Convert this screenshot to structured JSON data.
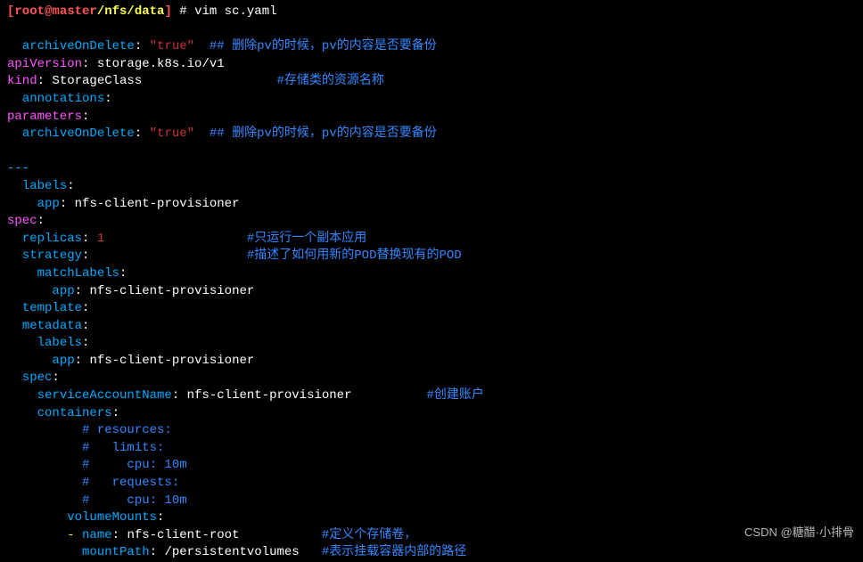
{
  "prompt": {
    "open_bracket": "[",
    "user_host": "root@master",
    "path": "/nfs/data",
    "close_bracket": "]",
    "hash": " # ",
    "command": "vim sc.yaml"
  },
  "lines": [
    {
      "indent": "  ",
      "key": "archiveOnDelete",
      "colon": ": ",
      "val": "\"true\"",
      "vclass": "val-str",
      "kclass": "key0",
      "after": "  ",
      "comment": "## 删除pv的时候，pv的内容是否要备份"
    },
    {
      "indent": "",
      "key": "apiVersion",
      "colon": ": ",
      "val": "storage.k8s.io/v1",
      "vclass": "val-plain",
      "kclass": "key1"
    },
    {
      "indent": "",
      "key": "kind",
      "colon": ": ",
      "val": "StorageClass",
      "vclass": "val-plain",
      "kclass": "key1",
      "after": "                  ",
      "comment": "#存储类的资源名称"
    },
    {
      "indent": "  ",
      "key": "annotations",
      "colon": ":",
      "kclass": "key0"
    },
    {
      "indent": "",
      "key": "parameters",
      "colon": ":",
      "kclass": "key1"
    },
    {
      "indent": "  ",
      "key": "archiveOnDelete",
      "colon": ": ",
      "val": "\"true\"",
      "vclass": "val-str",
      "kclass": "key0",
      "after": "  ",
      "comment": "## 删除pv的时候，pv的内容是否要备份"
    },
    {
      "blank": true
    },
    {
      "sep": "---"
    },
    {
      "indent": "  ",
      "key": "labels",
      "colon": ":",
      "kclass": "key0"
    },
    {
      "indent": "    ",
      "key": "app",
      "colon": ": ",
      "val": "nfs-client-provisioner",
      "vclass": "val-plain",
      "kclass": "key3"
    },
    {
      "indent": "",
      "key": "spec",
      "colon": ":",
      "kclass": "key1"
    },
    {
      "indent": "  ",
      "key": "replicas",
      "colon": ": ",
      "val": "1",
      "vclass": "val-num",
      "kclass": "key0",
      "after": "                   ",
      "comment": "#只运行一个副本应用"
    },
    {
      "indent": "  ",
      "key": "strategy",
      "colon": ":",
      "kclass": "key0",
      "after": "                     ",
      "comment": "#描述了如何用新的POD替换现有的POD"
    },
    {
      "indent": "    ",
      "key": "matchLabels",
      "colon": ":",
      "kclass": "key3"
    },
    {
      "indent": "      ",
      "key": "app",
      "colon": ": ",
      "val": "nfs-client-provisioner",
      "vclass": "val-plain",
      "kclass": "key4"
    },
    {
      "indent": "  ",
      "key": "template",
      "colon": ":",
      "kclass": "key0"
    },
    {
      "indent": "  ",
      "key": "metadata",
      "colon": ":",
      "kclass": "key0"
    },
    {
      "indent": "    ",
      "key": "labels",
      "colon": ":",
      "kclass": "key3"
    },
    {
      "indent": "      ",
      "key": "app",
      "colon": ": ",
      "val": "nfs-client-provisioner",
      "vclass": "val-plain",
      "kclass": "key4"
    },
    {
      "indent": "  ",
      "key": "spec",
      "colon": ":",
      "kclass": "key0"
    },
    {
      "indent": "    ",
      "key": "serviceAccountName",
      "colon": ": ",
      "val": "nfs-client-provisioner",
      "vclass": "val-plain",
      "kclass": "key3",
      "after": "          ",
      "comment": "#创建账户"
    },
    {
      "indent": "    ",
      "key": "containers",
      "colon": ":",
      "kclass": "key3"
    },
    {
      "indent": "          ",
      "comment_only": "# resources:"
    },
    {
      "indent": "          ",
      "comment_only": "#   limits:"
    },
    {
      "indent": "          ",
      "comment_only": "#     cpu: 10m"
    },
    {
      "indent": "          ",
      "comment_only": "#   requests:"
    },
    {
      "indent": "          ",
      "comment_only": "#     cpu: 10m"
    },
    {
      "indent": "        ",
      "key": "volumeMounts",
      "colon": ":",
      "kclass": "key4"
    },
    {
      "indent": "        ",
      "dash": "- ",
      "key": "name",
      "colon": ": ",
      "val": "nfs-client-root",
      "vclass": "val-plain",
      "kclass": "key4",
      "after": "           ",
      "comment": "#定义个存储卷，"
    },
    {
      "indent": "          ",
      "key": "mountPath",
      "colon": ": ",
      "val": "/persistentvolumes",
      "vclass": "val-plain",
      "kclass": "key4",
      "after": "   ",
      "comment": "#表示挂载容器内部的路径"
    }
  ],
  "watermark": "CSDN @糖醋·小排骨"
}
